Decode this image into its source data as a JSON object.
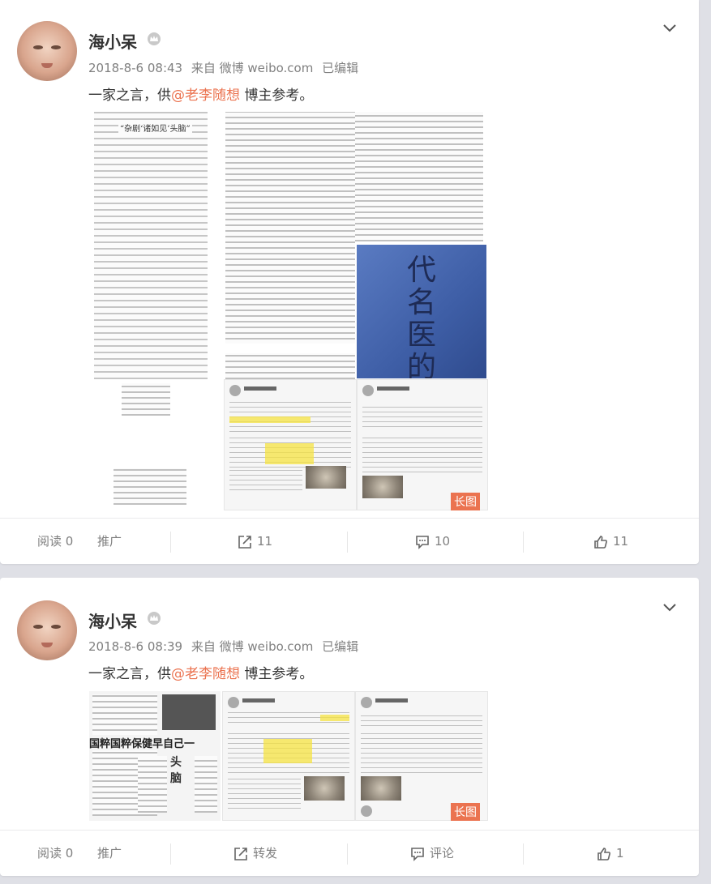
{
  "posts": [
    {
      "username": "海小呆",
      "time": "2018-8-6 08:43",
      "source": "来自 微博 weibo.com",
      "edited": "已编辑",
      "text_before": "一家之言，供",
      "mention": "@老李随想",
      "text_after": " 博主参考。",
      "scan_title": "“杂剧‘诸如见’头脑”",
      "book_title": "代名医的传",
      "long_badge": "长图",
      "footer": {
        "read": "阅读 0",
        "promote": "推广",
        "repost": "11",
        "comment": "10",
        "like": "11"
      }
    },
    {
      "username": "海小呆",
      "time": "2018-8-6 08:39",
      "source": "来自 微博 weibo.com",
      "edited": "已编辑",
      "text_before": "一家之言，供",
      "mention": "@老李随想",
      "text_after": " 博主参考。",
      "ad_title": "国粹国粹保健早自己一",
      "ad_side": "头 脑",
      "long_badge": "长图",
      "footer": {
        "read": "阅读 0",
        "promote": "推广",
        "repost": "转发",
        "comment": "评论",
        "like": "1"
      }
    }
  ],
  "colors": {
    "mention": "#eb7350",
    "badge": "#eb7350",
    "meta": "#808080"
  },
  "icons": [
    "chevron-down-icon",
    "vip-crown-icon",
    "repost-icon",
    "comment-icon",
    "like-icon"
  ]
}
